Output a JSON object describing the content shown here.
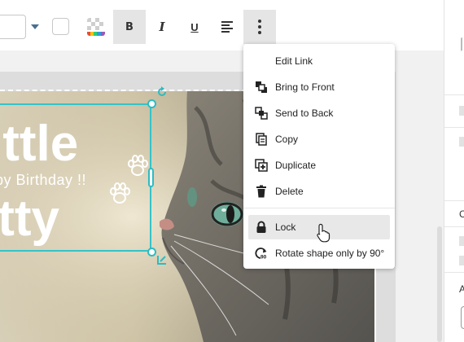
{
  "toolbar": {
    "bold_label": "B",
    "italic_label": "I",
    "underline_label": "U",
    "swatch_color": "#ffffff"
  },
  "artwork": {
    "line1": "ittle",
    "line2": "py Birthday !!",
    "line3": "itty",
    "selection_color": "#34c3c9"
  },
  "menu": {
    "items": [
      {
        "label": "Edit Link",
        "icon": "none"
      },
      {
        "label": "Bring to Front",
        "icon": "bring-front-icon"
      },
      {
        "label": "Send to Back",
        "icon": "send-back-icon"
      },
      {
        "label": "Copy",
        "icon": "copy-icon"
      },
      {
        "label": "Duplicate",
        "icon": "duplicate-icon"
      },
      {
        "label": "Delete",
        "icon": "trash-icon"
      },
      {
        "label": "Lock",
        "icon": "lock-icon"
      },
      {
        "label": "Rotate shape only by 90°",
        "icon": "rotate-90-icon"
      }
    ],
    "rotate_badge": "90"
  },
  "right_panel": {
    "letter_c": "C",
    "letter_a": "A"
  }
}
